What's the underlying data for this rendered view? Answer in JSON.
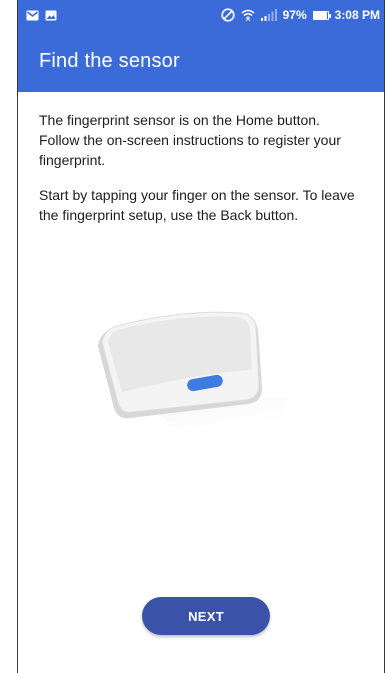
{
  "status_bar": {
    "battery": "97%",
    "battery_level": 0.97,
    "time": "3:08 PM",
    "icons": [
      "gmail-icon",
      "image-icon",
      "do-not-disturb-icon",
      "wifi-icon",
      "signal-icon",
      "battery-icon"
    ]
  },
  "header": {
    "title": "Find the sensor"
  },
  "content": {
    "paragraph_1": "The fingerprint sensor is on the Home button. Follow the on-screen instructions to register your fingerprint.",
    "paragraph_2": "Start by tapping your finger on the sensor. To leave the fingerprint setup, use the Back button."
  },
  "illustration": {
    "icon": "phone-home-button-illustration",
    "accent": "#3f7be0"
  },
  "actions": {
    "next_label": "NEXT"
  },
  "colors": {
    "primary": "#3a6bd8",
    "button": "#3a53a8"
  }
}
